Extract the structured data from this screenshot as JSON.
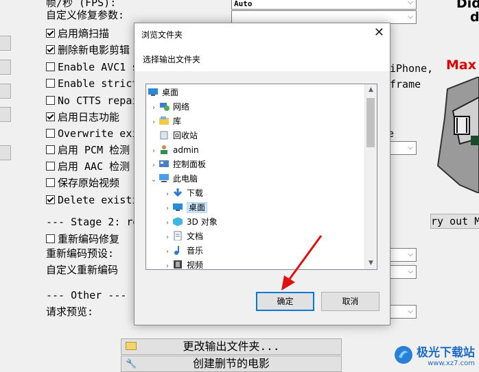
{
  "background": {
    "top_combo_value": "Auto",
    "lines": [
      {
        "text": "帧/秒 (FPS):",
        "checkbox": null
      },
      {
        "text": "自定义修复参数:",
        "checkbox": null
      },
      {
        "text": "启用熵扫描",
        "checkbox": true
      },
      {
        "text": "删除新电影剪辑",
        "checkbox": true
      },
      {
        "text": "Enable AVC1 s",
        "checkbox": false
      },
      {
        "text": "Enable strict",
        "checkbox": false
      },
      {
        "text": "No CTTS repai",
        "checkbox": false
      },
      {
        "text": "启用日志功能",
        "checkbox": true
      },
      {
        "text": "Overwrite exi",
        "checkbox": false
      },
      {
        "text": "启用 PCM 检测",
        "checkbox": false
      },
      {
        "text": "启用 AAC 检测",
        "checkbox": false
      },
      {
        "text": "保存原始视频",
        "checkbox": false
      },
      {
        "text": "Delete existi",
        "checkbox": true
      },
      {
        "text": "--- Stage 2: re",
        "checkbox": null
      },
      {
        "text": "重新编码修复",
        "checkbox": false
      },
      {
        "text": "重新编码预设:",
        "checkbox": null
      },
      {
        "text": "自定义重新编码",
        "checkbox": null
      },
      {
        "text": "--- Other ---",
        "checkbox": null
      },
      {
        "text": "请求预览:",
        "checkbox": null
      }
    ],
    "right_text_iphone": "iPhone,",
    "right_text_frame": "frame",
    "right_text_e": "e",
    "right_text_carry": "ry out M",
    "logo_text_1": "Did",
    "logo_text_2": "d",
    "logo_red": "Max",
    "btn_change_output": "更改输出文件夹...",
    "btn_create_cut": "创建删节的电影"
  },
  "dialog": {
    "title": "浏览文件夹",
    "prompt": "选择输出文件夹",
    "tree": [
      {
        "label": "桌面",
        "level": 0,
        "icon": "desktop-icon",
        "chevron": ""
      },
      {
        "label": "网络",
        "level": 1,
        "icon": "network-icon",
        "chevron": ">"
      },
      {
        "label": "库",
        "level": 1,
        "icon": "library-icon",
        "chevron": ">"
      },
      {
        "label": "回收站",
        "level": 1,
        "icon": "recycle-bin-icon",
        "chevron": ""
      },
      {
        "label": "admin",
        "level": 1,
        "icon": "user-icon",
        "chevron": ">"
      },
      {
        "label": "控制面板",
        "level": 1,
        "icon": "control-panel-icon",
        "chevron": ">"
      },
      {
        "label": "此电脑",
        "level": 1,
        "icon": "computer-icon",
        "chevron": "v"
      },
      {
        "label": "下载",
        "level": 2,
        "icon": "download-icon",
        "chevron": ">"
      },
      {
        "label": "桌面",
        "level": 2,
        "icon": "desktop-icon",
        "chevron": ">",
        "selected": true
      },
      {
        "label": "3D 对象",
        "level": 2,
        "icon": "3d-objects-icon",
        "chevron": ">"
      },
      {
        "label": "文档",
        "level": 2,
        "icon": "documents-icon",
        "chevron": ">"
      },
      {
        "label": "音乐",
        "level": 2,
        "icon": "music-icon",
        "chevron": ">"
      },
      {
        "label": "视频",
        "level": 2,
        "icon": "video-icon",
        "chevron": ">"
      }
    ],
    "ok_label": "确定",
    "cancel_label": "取消"
  },
  "watermark": {
    "title": "极光下载站",
    "url": "www.xz7.com"
  }
}
